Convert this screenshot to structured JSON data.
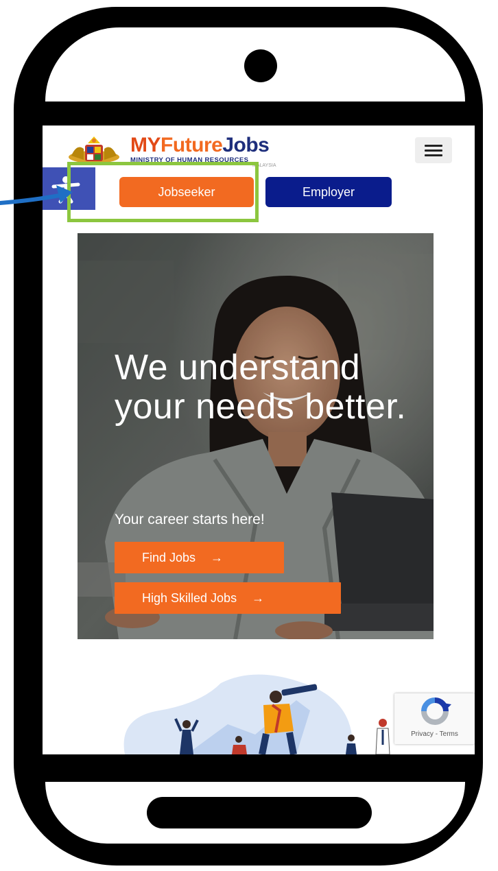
{
  "header": {
    "brand": {
      "my": "MY",
      "future": "Future",
      "jobs": "Jobs"
    },
    "ministry": "MINISTRY OF HUMAN RESOURCES",
    "ministry_sub": "MALAYSIA",
    "menu_icon": "hamburger-menu-icon"
  },
  "accessibility": {
    "icon": "accessibility-icon"
  },
  "user_type": {
    "jobseeker_label": "Jobseeker",
    "employer_label": "Employer"
  },
  "hero": {
    "headline": "We understand your needs better.",
    "subtitle": "Your career starts here!",
    "find_jobs_label": "Find Jobs",
    "high_skilled_label": "High Skilled Jobs",
    "arrow": "→"
  },
  "recaptcha": {
    "links": "Privacy - Terms"
  },
  "colors": {
    "brand_orange": "#f26a21",
    "brand_navy": "#0a1c8c",
    "accessibility_blue": "#3f51b5",
    "highlight_green": "#8cc63f",
    "annotation_blue": "#1f6fc5"
  }
}
